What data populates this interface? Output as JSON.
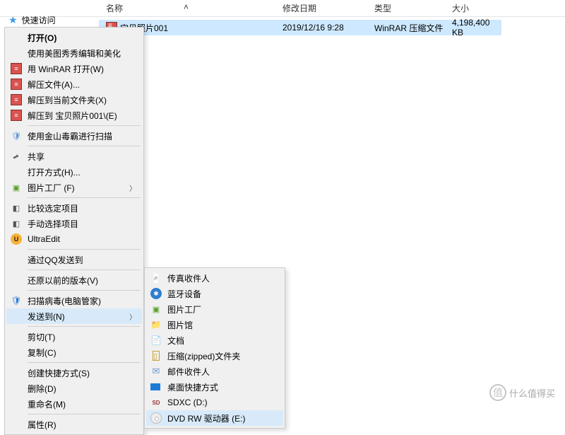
{
  "sidebar": {
    "quick_access": "快速访问"
  },
  "columns": {
    "name": "名称",
    "date": "修改日期",
    "type": "类型",
    "size": "大小"
  },
  "file": {
    "name": "宝贝照片001",
    "date": "2019/12/16 9:28",
    "type": "WinRAR 压缩文件",
    "size": "4,198,400 KB"
  },
  "menu": {
    "open": "打开(O)",
    "meitu": "使用美图秀秀编辑和美化",
    "winrar_open": "用 WinRAR 打开(W)",
    "extract": "解压文件(A)...",
    "extract_here": "解压到当前文件夹(X)",
    "extract_named": "解压到 宝贝照片001\\(E)",
    "duba_scan": "使用金山毒霸进行扫描",
    "share": "共享",
    "open_with": "打开方式(H)...",
    "pic_factory": "图片工厂 (F)",
    "compare": "比较选定项目",
    "manual_sel": "手动选择项目",
    "ultraedit": "UltraEdit",
    "qq_send": "通过QQ发送到",
    "prev_ver": "还原以前的版本(V)",
    "virus_scan": "扫描病毒(电脑管家)",
    "send_to": "发送到(N)",
    "cut": "剪切(T)",
    "copy": "复制(C)",
    "shortcut": "创建快捷方式(S)",
    "delete": "删除(D)",
    "rename": "重命名(M)",
    "properties": "属性(R)"
  },
  "sendto": {
    "fax": "传真收件人",
    "bluetooth": "蓝牙设备",
    "pic_factory": "图片工厂",
    "pic_gallery": "图片馆",
    "documents": "文档",
    "zip": "压缩(zipped)文件夹",
    "mail": "邮件收件人",
    "desktop": "桌面快捷方式",
    "sdxc": "SDXC (D:)",
    "dvd": "DVD RW 驱动器 (E:)"
  },
  "watermark": "什么值得买"
}
